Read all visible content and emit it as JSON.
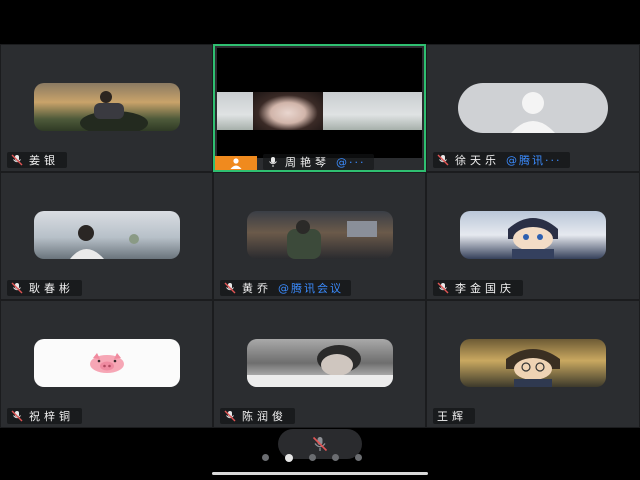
{
  "participants": [
    {
      "name": "姜银",
      "org": ""
    },
    {
      "name": "周艳琴",
      "org": "@···"
    },
    {
      "name": "徐天乐",
      "org": "@腾讯···"
    },
    {
      "name": "耿春彬",
      "org": ""
    },
    {
      "name": "黄乔",
      "org": "@腾讯会议"
    },
    {
      "name": "李金国庆",
      "org": ""
    },
    {
      "name": "祝梓铜",
      "org": ""
    },
    {
      "name": "陈润俊",
      "org": ""
    },
    {
      "name": "王辉",
      "org": ""
    }
  ],
  "pager": {
    "total": 5,
    "active": 2
  },
  "colors": {
    "active_border": "#2fbf71",
    "host_badge": "#f08a1e",
    "org_link": "#3b8cff"
  },
  "icons": {
    "mic_muted": "mic-muted-icon",
    "mic": "mic-icon",
    "host": "host-person-icon",
    "avatar_placeholder": "person-silhouette-icon",
    "pig": "pig-emoji-icon"
  }
}
